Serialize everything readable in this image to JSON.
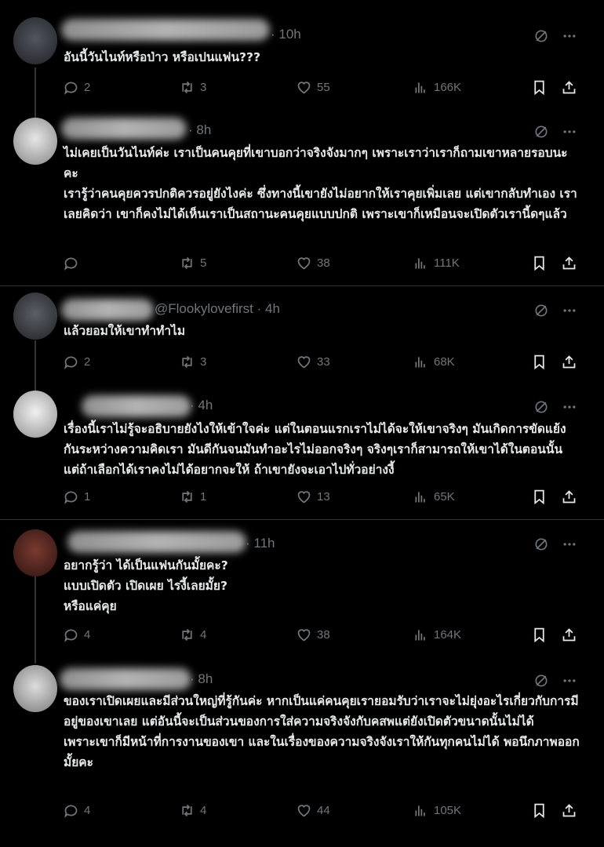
{
  "colors": {
    "background": "#000000",
    "text": "#e7e9ea",
    "muted": "#71767b",
    "divider": "#2f3336"
  },
  "posts": [
    {
      "time": "· 10h",
      "text": "อันนี้วันไนท์หรือป่าว หรือเปนแฟน???",
      "replies": "2",
      "retweets": "3",
      "likes": "55",
      "views": "166K"
    },
    {
      "time": "· 8h",
      "text": "ไม่เคยเป็นวันไนท์ค่ะ เราเป็นคนคุยที่เขาบอกว่าจริงจังมากๆ เพราะเราว่าเราก็ถามเขาหลายรอบนะคะ\nเรารู้ว่าคนคุยควรปกติควรอยู่ยังไงค่ะ ซึ่งทางนี้เขายังไม่อยากให้เราคุยเพิ่มเลย แต่เขากลับทำเอง เราเลยคิดว่า เขาก็คงไม่ได้เห็นเราเป็นสถานะคนคุยแบบปกติ  เพราะเขาก็เหมือนจะเปิดตัวเรานี้ดๆแล้ว",
      "replies": "",
      "retweets": "5",
      "likes": "38",
      "views": "111K"
    },
    {
      "time": "@Flookylovefirst · 4h",
      "text": "แล้วยอมให้เขาทำทำไม",
      "replies": "2",
      "retweets": "3",
      "likes": "33",
      "views": "68K"
    },
    {
      "time": "· 4h",
      "text": "เรื่องนี้เราไม่รู้จะอธิบายยังไงให้เข้าใจค่ะ แต่ในตอนแรกเราไม่ได้จะให้เขาจริงๆ มันเกิดการขัดแย้งกันระหว่างความคิดเรา มันดีกันจนมันทำอะไรไม่ออกจริงๆ จริงๆเราก็สามารถให้เขาได้ในตอนนั้น แต่ถ้าเลือกได้เราคงไม่ได้อยากจะให้ ถ้าเขายังจะเอาไปทั่วอย่างงี้",
      "replies": "1",
      "retweets": "1",
      "likes": "13",
      "views": "65K"
    },
    {
      "time": "· 11h",
      "text": "อยากรู้ว่า ได้เป็นแฟนกันมั้ยคะ?\nแบบเปิดตัว เปิดเผย ไรงี้เลยมั้ย?\nหรือแค่คุย",
      "replies": "4",
      "retweets": "4",
      "likes": "38",
      "views": "164K"
    },
    {
      "time": "· 8h",
      "text": "ของเราเปิดเผยและมีส่วนใหญ่ที่รู้กันค่ะ หากเป็นแค่คนคุยเรายอมรับว่าเราจะไม่ยุ่งอะไรเกี่ยวกับการมีอยู่ของเขาเลย แต่อันนี้จะเป็นส่วนของการใส่ความจริงจังกับคสพแต่ยังเปิดตัวขนาดนั้นไม่ได้\nเพราะเขาก็มีหน้าที่การงานของเขา และในเรื่องของความจริงจังเราให้กันทุกคนไม่ได้ พอนึกภาพออกมั้ยคะ",
      "replies": "4",
      "retweets": "4",
      "likes": "44",
      "views": "105K"
    }
  ]
}
